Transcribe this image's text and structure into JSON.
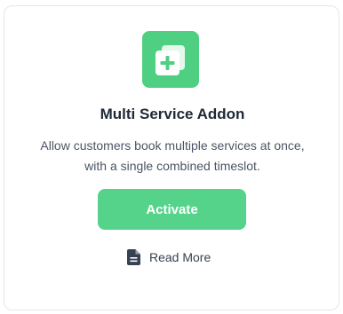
{
  "card": {
    "title": "Multi Service Addon",
    "description": "Allow customers book multiple services at once, with a single combined timeslot.",
    "activate_label": "Activate",
    "read_more_label": "Read More",
    "icon": "copy-plus-icon",
    "doc_icon": "document-icon"
  },
  "colors": {
    "accent": "#4fcf82",
    "button": "#55d38a",
    "title": "#1f2937",
    "text": "#4b5563"
  }
}
